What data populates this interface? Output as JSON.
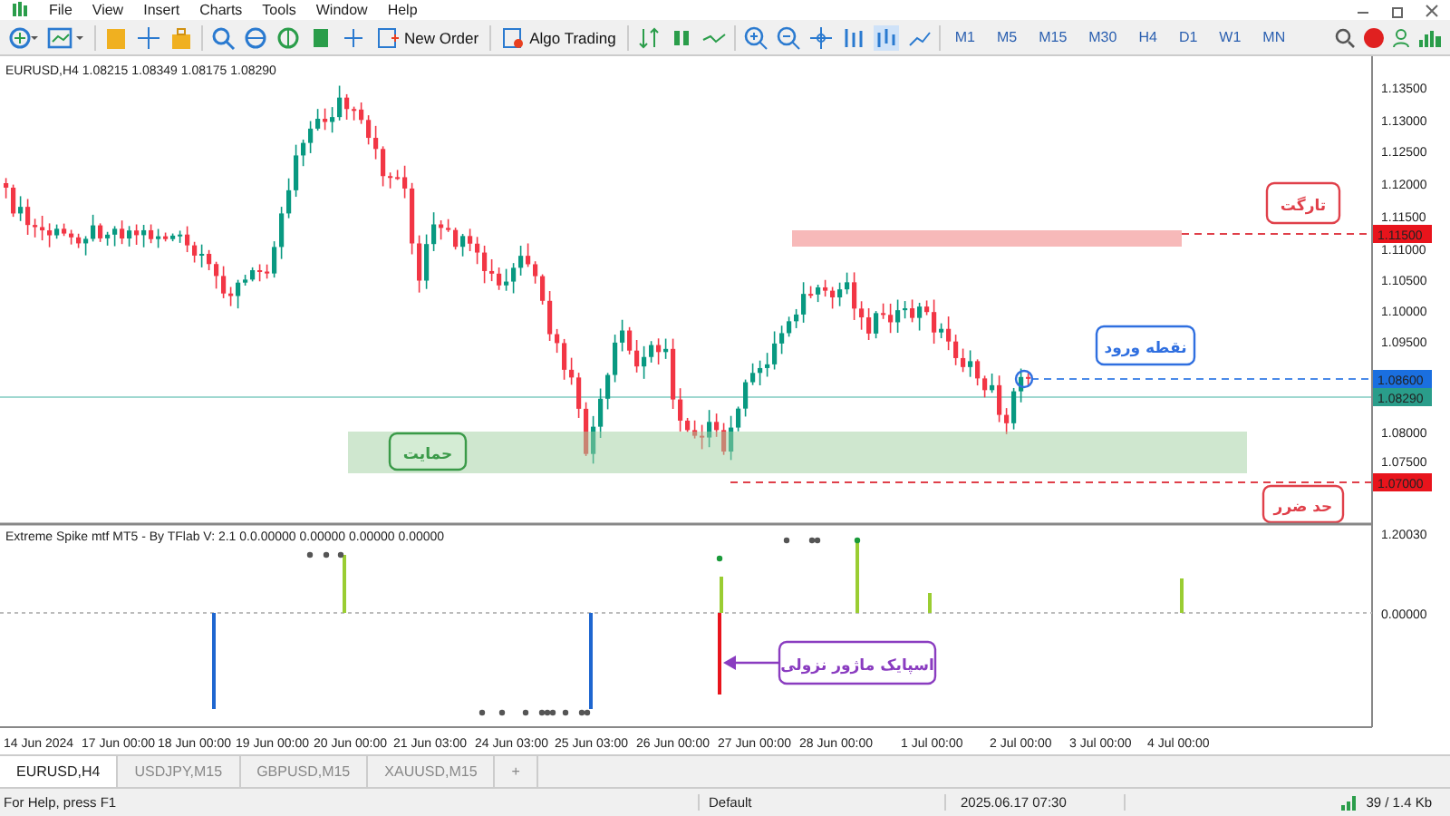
{
  "menu": [
    "File",
    "View",
    "Insert",
    "Charts",
    "Tools",
    "Window",
    "Help"
  ],
  "toolbar": {
    "buttons": [
      "New Order",
      "Algo Trading"
    ],
    "timeframes": [
      "M1",
      "M5",
      "M15",
      "M30",
      "H4",
      "D1",
      "W1",
      "MN"
    ]
  },
  "chart": {
    "header": "EURUSD,H4  1.08215 1.08349 1.08175 1.08290",
    "price_ticks": [
      "1.13500",
      "1.13000",
      "1.12500",
      "1.12000",
      "1.11500",
      "1.11000",
      "1.10500",
      "1.10000",
      "1.09500",
      "1.08000",
      "1.07500"
    ],
    "price_markers": [
      {
        "text": "1.11500",
        "color": "#e8141c"
      },
      {
        "text": "1.08600",
        "color": "#1a6fe0"
      },
      {
        "text": "1.08290",
        "color": "#2a9d8a"
      },
      {
        "text": "1.07000",
        "color": "#e8141c"
      }
    ],
    "annotations": [
      {
        "kind": "target",
        "text": "تارگت",
        "color": "#e0404a"
      },
      {
        "kind": "entry",
        "text": "نقطه ورود",
        "color": "#2f6fe0"
      },
      {
        "kind": "support",
        "text": "حمایت",
        "color": "#3a9a48"
      },
      {
        "kind": "stop",
        "text": "حد ضرر",
        "color": "#e0404a"
      },
      {
        "kind": "spike",
        "text": "اسپایک ماژور نزولی",
        "color": "#8a3cc0"
      }
    ],
    "indicator": {
      "title": "Extreme Spike mtf MT5 - By TFlab  V: 2.1 0.0.00000 0.00000 0.00000 0.00000",
      "ticks": [
        "1.20030",
        "0.00000"
      ]
    },
    "time_labels": [
      "14 Jun 2024",
      "17 Jun 00:00",
      "18 Jun 00:00",
      "19 Jun 00:00",
      "20 Jun 00:00",
      "21 Jun 03:00",
      "24 Jun 03:00",
      "25 Jun 03:00",
      "26 Jun 00:00",
      "27 Jun 00:00",
      "28 Jun 00:00",
      "1 Jul 00:00",
      "2 Jul 00:00",
      "3 Jul 00:00",
      "4 Jul 00:00"
    ]
  },
  "tabs": [
    {
      "label": "EURUSD,H4",
      "selected": true
    },
    {
      "label": "USDJPY,M15",
      "selected": false
    },
    {
      "label": "GBPUSD,M15",
      "selected": false
    },
    {
      "label": "XAUUSD,M15",
      "selected": false
    },
    {
      "label": "+",
      "selected": false
    }
  ],
  "status_bar": {
    "help": "For Help, press F1",
    "profile": "Default",
    "datetime": "2025.06.17 07:30",
    "traffic": "39 / 1.4 Kb"
  }
}
